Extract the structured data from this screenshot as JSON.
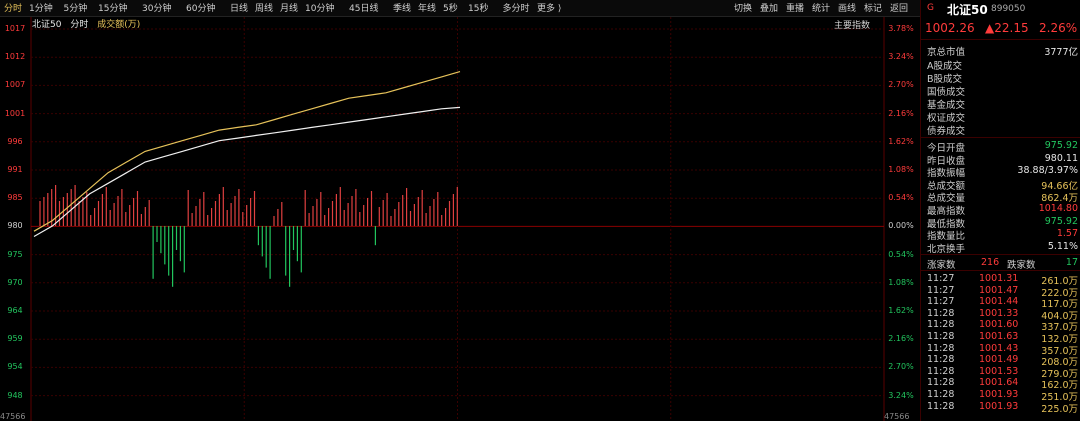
{
  "toolbar": {
    "left_items": [
      "分时",
      "1分钟",
      "5分钟",
      "15分钟",
      "30分钟",
      "60分钟",
      "日线",
      "周线",
      "月线",
      "10分钟",
      "45日线",
      "季线",
      "年线",
      "5秒",
      "15秒",
      "多分时",
      "更多 ⟩"
    ],
    "right_items": [
      "切换",
      "叠加",
      "重播",
      "统计",
      "画线",
      "标记",
      "返回"
    ]
  },
  "chart": {
    "legend": {
      "name": "北证50",
      "tab1": "分时",
      "tab2": "成交额(万)"
    },
    "top_right_label": "主要指数",
    "left_ticks": [
      "1017",
      "1012",
      "1007",
      "1001",
      "996",
      "991",
      "985",
      "980",
      "975",
      "970",
      "964",
      "959",
      "954",
      "948"
    ],
    "right_ticks": [
      "3.78%",
      "3.24%",
      "2.70%",
      "2.16%",
      "1.62%",
      "1.08%",
      "0.54%",
      "0.00%",
      "0.54%",
      "1.08%",
      "1.62%",
      "2.16%",
      "2.70%",
      "3.24%"
    ],
    "bottom_left": "47566",
    "bottom_right": "47566"
  },
  "chart_data": {
    "type": "line",
    "ylim": [
      945,
      1020
    ],
    "baseline": 980.11,
    "white_line": [
      978,
      980,
      983,
      986,
      988,
      990,
      992,
      993,
      994,
      995,
      996,
      996.5,
      997,
      997.5,
      998,
      998.5,
      999,
      999.5,
      1000,
      1000.5,
      1001,
      1001.5,
      1002,
      1002.26
    ],
    "yellow_line": [
      979,
      981,
      984,
      987,
      990,
      992,
      994,
      995,
      996,
      997,
      998,
      998.5,
      999,
      1000,
      1001,
      1002,
      1003,
      1004,
      1004.5,
      1005,
      1006,
      1007,
      1008,
      1009
    ]
  },
  "panel": {
    "header": {
      "flag": "G",
      "name": "北证50",
      "code": "899050"
    },
    "quote": {
      "price": "1002.26",
      "change": "▲22.15",
      "pct": "2.26%"
    },
    "market_cap_label": "京总市值",
    "market_cap_value": "3777亿",
    "groups": [
      "A股成交",
      "B股成交",
      "国债成交",
      "基金成交",
      "权证成交",
      "债券成交"
    ],
    "stats": [
      {
        "label": "今日开盘",
        "value": "975.92",
        "color": "green"
      },
      {
        "label": "昨日收盘",
        "value": "980.11",
        "color": "white"
      },
      {
        "label": "指数振幅",
        "value": "38.88/3.97%",
        "color": "white"
      },
      {
        "label": "总成交额",
        "value": "94.66亿",
        "color": "yellow"
      },
      {
        "label": "总成交量",
        "value": "862.4万",
        "color": "yellow"
      },
      {
        "label": "最高指数",
        "value": "1014.80",
        "color": "red"
      },
      {
        "label": "最低指数",
        "value": "975.92",
        "color": "green"
      },
      {
        "label": "指数量比",
        "value": "1.57",
        "color": "red"
      },
      {
        "label": "北京换手",
        "value": "5.11%",
        "color": "white"
      }
    ],
    "breadth": {
      "up_label": "涨家数",
      "up": "216",
      "down_label": "跌家数",
      "down": "17"
    },
    "trades": [
      [
        "11:27",
        "1001.31",
        "261.0万"
      ],
      [
        "11:27",
        "1001.47",
        "222.0万"
      ],
      [
        "11:27",
        "1001.44",
        "117.0万"
      ],
      [
        "11:28",
        "1001.33",
        "404.0万"
      ],
      [
        "11:28",
        "1001.60",
        "337.0万"
      ],
      [
        "11:28",
        "1001.63",
        "132.0万"
      ],
      [
        "11:28",
        "1001.43",
        "357.0万"
      ],
      [
        "11:28",
        "1001.49",
        "208.0万"
      ],
      [
        "11:28",
        "1001.53",
        "279.0万"
      ],
      [
        "11:28",
        "1001.64",
        "162.0万"
      ],
      [
        "11:28",
        "1001.93",
        "251.0万"
      ],
      [
        "11:28",
        "1001.93",
        "225.0万"
      ]
    ]
  }
}
